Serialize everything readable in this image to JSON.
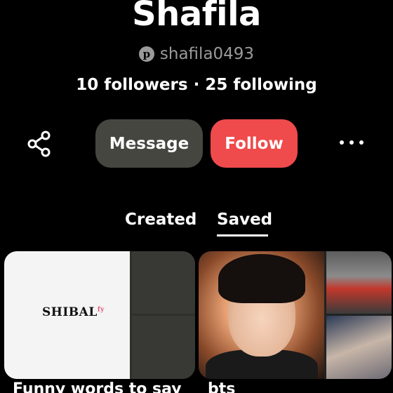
{
  "profile": {
    "name": "Shafila",
    "handle": "shafila0493",
    "stats": "10 followers · 25 following"
  },
  "actions": {
    "message_label": "Message",
    "follow_label": "Follow"
  },
  "icons": {
    "share": "share-icon",
    "more": "more-options-icon",
    "pinterest": "pinterest-logo-icon"
  },
  "tabs": [
    {
      "label": "Created",
      "active": false
    },
    {
      "label": "Saved",
      "active": true
    }
  ],
  "boards": [
    {
      "title": "Funny words to say",
      "cover_text": "SHIBAL",
      "cover_mark": "fy"
    },
    {
      "title": "bts"
    }
  ],
  "colors": {
    "follow_button": "#ef4a4c",
    "message_button": "#45463f",
    "background": "#000000"
  }
}
